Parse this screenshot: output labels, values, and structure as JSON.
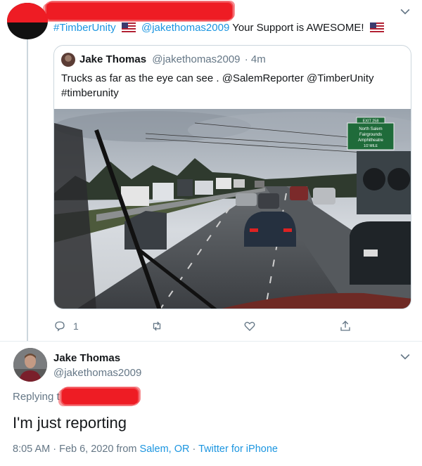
{
  "top_tweet": {
    "text_prefix": "#TimberUnity",
    "mention": "@jakethomas2009",
    "text_suffix": "Your Support is AWESOME!",
    "flag_icon": "us-flag-icon",
    "quoted": {
      "name": "Jake Thomas",
      "handle": "@jakethomas2009",
      "time": "· 4m",
      "text_lines": [
        "Trucks as far as the eye can see . @SalemReporter @TimberUnity",
        "#timberunity"
      ],
      "sign_text": {
        "exit": "EXIT 258",
        "line1": "North Salem",
        "line2": "Fairgrounds",
        "line3": "Amphitheatre",
        "line4": "1/2 MILE"
      }
    },
    "actions": {
      "reply_count": "1"
    }
  },
  "main_tweet": {
    "name": "Jake Thomas",
    "handle": "@jakethomas2009",
    "replying_label": "Replying t",
    "text": "I'm just reporting",
    "time": "8:05 AM · Feb 6, 2020 from",
    "location": "Salem, OR",
    "dot": "·",
    "source": "Twitter for iPhone"
  },
  "colors": {
    "link": "#1b95e0",
    "muted": "#657786",
    "redaction": "#ee1c24",
    "border": "#ccd6dd"
  }
}
